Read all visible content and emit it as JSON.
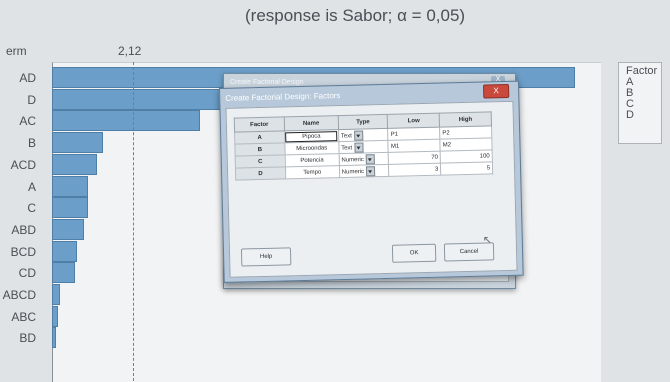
{
  "chart": {
    "title": "(response is Sabor; α = 0,05)",
    "term_header": "erm",
    "critical_value": "2,12",
    "legend": {
      "title": "Factor",
      "items": [
        "A",
        "B",
        "C",
        "D"
      ]
    }
  },
  "chart_data": {
    "type": "bar",
    "orientation": "horizontal",
    "title": "(response is Sabor; α = 0,05)",
    "categories": [
      "AD",
      "D",
      "AC",
      "B",
      "ACD",
      "A",
      "C",
      "ABD",
      "BCD",
      "CD",
      "ABCD",
      "ABC",
      "BD"
    ],
    "category_labels": [
      "AD",
      "D",
      "AC",
      "B",
      "ACD",
      "A",
      "C",
      "ABD",
      "BCD",
      "CD",
      "ABCD",
      "ABC",
      "BD"
    ],
    "values": [
      13.8,
      12.2,
      3.9,
      1.35,
      1.2,
      0.95,
      0.95,
      0.85,
      0.65,
      0.6,
      0.2,
      0.15,
      0.1
    ],
    "reference_line": 2.12,
    "reference_label": "2,12",
    "xlim": [
      0,
      15
    ]
  },
  "dialog_back": {
    "title": "Create Factorial Design",
    "close": "X"
  },
  "dialog": {
    "title": "Create Factorial Design: Factors",
    "close": "X",
    "columns": [
      "Factor",
      "Name",
      "Type",
      "Low",
      "High"
    ],
    "rows": [
      {
        "factor": "A",
        "name": "Pipoca",
        "type": "Text",
        "low": "P1",
        "high": "P2"
      },
      {
        "factor": "B",
        "name": "Microondas",
        "type": "Text",
        "low": "M1",
        "high": "M2"
      },
      {
        "factor": "C",
        "name": "Potencia",
        "type": "Numeric",
        "low": "70",
        "high": "100"
      },
      {
        "factor": "D",
        "name": "Tempo",
        "type": "Numeric",
        "low": "3",
        "high": "5"
      }
    ],
    "help_label": "Help",
    "ok_label": "OK",
    "cancel_label": "Cancel"
  }
}
